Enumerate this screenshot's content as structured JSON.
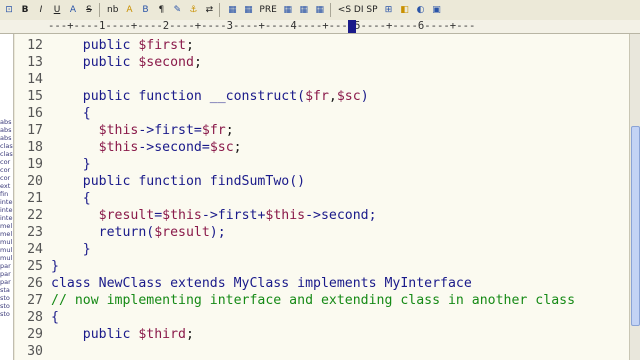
{
  "toolbar": {
    "buttons": [
      "⊡",
      "B",
      "I",
      "U",
      "A",
      "S",
      "nb",
      "A",
      "B",
      "¶",
      "✎",
      "⚓",
      "⇄",
      "▦",
      "▦",
      "PRE",
      "▦",
      "▦",
      "▦",
      "<S DI SP",
      "⊞",
      "◧",
      "◐",
      "▣"
    ]
  },
  "ruler": {
    "text": "---+----1----+----2----+----3----+----4----+----5----+----6----+---",
    "cursor_col": 3
  },
  "left_panel": {
    "items": [
      "abs",
      "abs",
      "abs",
      "clas",
      "clas",
      "cor",
      "cor",
      "cor",
      "ext",
      "fin",
      "inte",
      "inte",
      "inte",
      "mel",
      "mel",
      "mul",
      "mul",
      "mul",
      "par",
      "par",
      "par",
      "sta",
      "sto",
      "sto",
      "sto"
    ]
  },
  "code": {
    "lines": [
      {
        "n": "12",
        "tokens": [
          {
            "t": "    ",
            "c": "plain"
          },
          {
            "t": "public",
            "c": "kw"
          },
          {
            "t": " ",
            "c": "plain"
          },
          {
            "t": "$first",
            "c": "var"
          },
          {
            "t": ";",
            "c": "op"
          }
        ]
      },
      {
        "n": "13",
        "tokens": [
          {
            "t": "    ",
            "c": "plain"
          },
          {
            "t": "public",
            "c": "kw"
          },
          {
            "t": " ",
            "c": "plain"
          },
          {
            "t": "$second",
            "c": "var"
          },
          {
            "t": ";",
            "c": "op"
          }
        ]
      },
      {
        "n": "14",
        "tokens": []
      },
      {
        "n": "15",
        "tokens": [
          {
            "t": "    ",
            "c": "plain"
          },
          {
            "t": "public function __construct(",
            "c": "kw"
          },
          {
            "t": "$fr",
            "c": "var"
          },
          {
            "t": ",",
            "c": "op"
          },
          {
            "t": "$sc",
            "c": "var"
          },
          {
            "t": ")",
            "c": "kw"
          }
        ]
      },
      {
        "n": "16",
        "tokens": [
          {
            "t": "    {",
            "c": "kw"
          }
        ]
      },
      {
        "n": "17",
        "tokens": [
          {
            "t": "      ",
            "c": "plain"
          },
          {
            "t": "$this",
            "c": "var"
          },
          {
            "t": "->first=",
            "c": "kw"
          },
          {
            "t": "$fr",
            "c": "var"
          },
          {
            "t": ";",
            "c": "op"
          }
        ]
      },
      {
        "n": "18",
        "tokens": [
          {
            "t": "      ",
            "c": "plain"
          },
          {
            "t": "$this",
            "c": "var"
          },
          {
            "t": "->second=",
            "c": "kw"
          },
          {
            "t": "$sc",
            "c": "var"
          },
          {
            "t": ";",
            "c": "op"
          }
        ]
      },
      {
        "n": "19",
        "tokens": [
          {
            "t": "    }",
            "c": "kw"
          }
        ]
      },
      {
        "n": "20",
        "tokens": [
          {
            "t": "    ",
            "c": "plain"
          },
          {
            "t": "public function findSumTwo()",
            "c": "kw"
          }
        ]
      },
      {
        "n": "21",
        "tokens": [
          {
            "t": "    {",
            "c": "kw"
          }
        ]
      },
      {
        "n": "22",
        "tokens": [
          {
            "t": "      ",
            "c": "plain"
          },
          {
            "t": "$result",
            "c": "var"
          },
          {
            "t": "=",
            "c": "kw"
          },
          {
            "t": "$this",
            "c": "var"
          },
          {
            "t": "->first+",
            "c": "kw"
          },
          {
            "t": "$this",
            "c": "var"
          },
          {
            "t": "->second;",
            "c": "kw"
          }
        ]
      },
      {
        "n": "23",
        "tokens": [
          {
            "t": "      ",
            "c": "plain"
          },
          {
            "t": "return(",
            "c": "kw"
          },
          {
            "t": "$result",
            "c": "var"
          },
          {
            "t": ");",
            "c": "kw"
          }
        ]
      },
      {
        "n": "24",
        "tokens": [
          {
            "t": "    }",
            "c": "kw"
          }
        ]
      },
      {
        "n": "25",
        "tokens": [
          {
            "t": "}",
            "c": "kw"
          }
        ]
      },
      {
        "n": "26",
        "tokens": [
          {
            "t": "class NewClass extends MyClass implements MyInterface",
            "c": "cls"
          }
        ]
      },
      {
        "n": "27",
        "tokens": [
          {
            "t": "// now implementing interface and extending class in another class",
            "c": "cmt"
          }
        ]
      },
      {
        "n": "28",
        "tokens": [
          {
            "t": "{",
            "c": "kw"
          }
        ]
      },
      {
        "n": "29",
        "tokens": [
          {
            "t": "    ",
            "c": "plain"
          },
          {
            "t": "public",
            "c": "kw"
          },
          {
            "t": " ",
            "c": "plain"
          },
          {
            "t": "$third",
            "c": "var"
          },
          {
            "t": ";",
            "c": "op"
          }
        ]
      },
      {
        "n": "30",
        "tokens": []
      }
    ]
  },
  "colors": {
    "keyword": "#1a1a8a",
    "variable": "#8a1a4a",
    "comment": "#168a16",
    "editor_bg": "#fbfaf0",
    "chrome_bg": "#ece9d8"
  }
}
